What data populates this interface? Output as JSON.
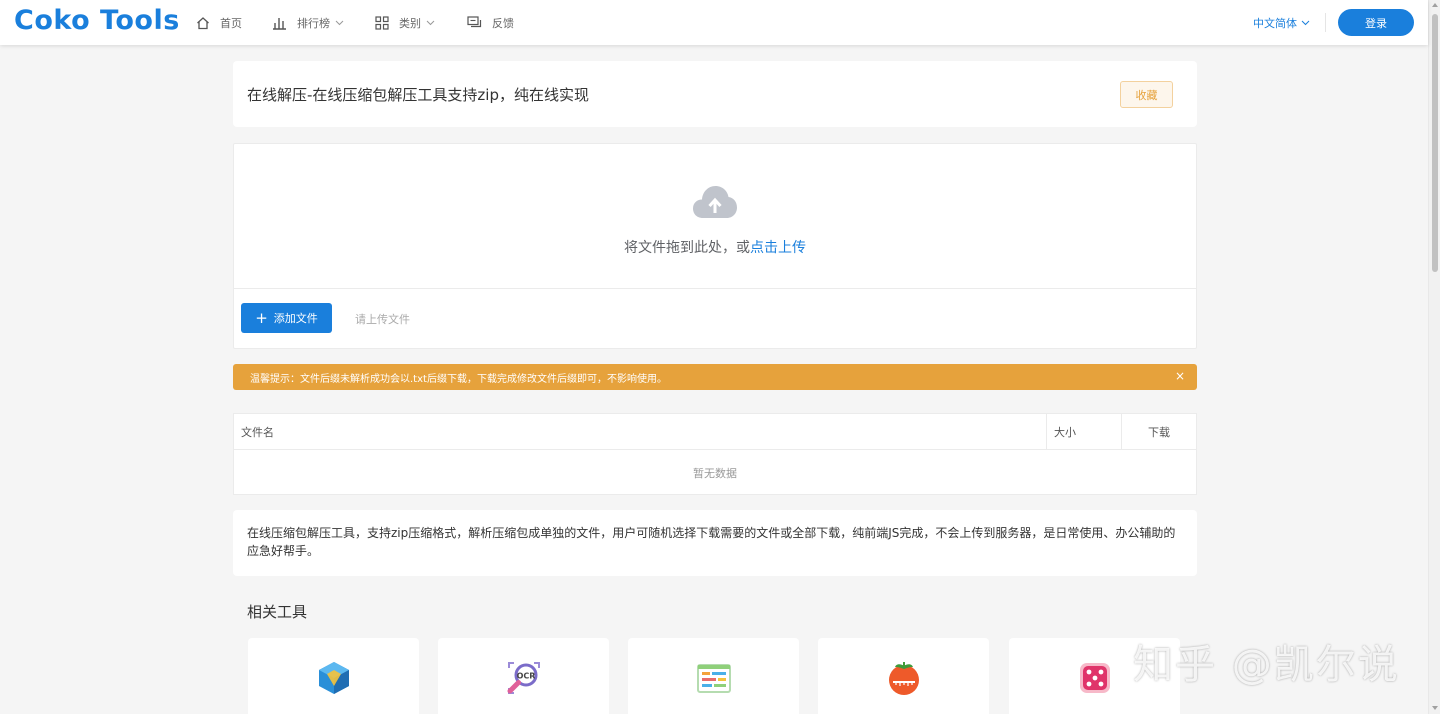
{
  "header": {
    "logo": "Coko Tools",
    "nav": [
      {
        "label": "首页",
        "icon": "home-icon"
      },
      {
        "label": "排行榜",
        "icon": "bar-chart-icon"
      },
      {
        "label": "类别",
        "icon": "grid-icon"
      },
      {
        "label": "反馈",
        "icon": "chat-icon"
      }
    ],
    "language": "中文简体",
    "login_label": "登录"
  },
  "page": {
    "title": "在线解压-在线压缩包解压工具支持zip，纯在线实现",
    "favorite_label": "收藏"
  },
  "upload": {
    "drop_text": "将文件拖到此处，或",
    "drop_link": "点击上传",
    "add_button": "添加文件",
    "hint": "请上传文件"
  },
  "alert": {
    "text": "温馨提示：文件后缀未解析成功会以.txt后缀下载，下载完成修改文件后缀即可，不影响使用。"
  },
  "table": {
    "columns": [
      "文件名",
      "大小",
      "下载"
    ],
    "empty_text": "暂无数据"
  },
  "description": "在线压缩包解压工具，支持zip压缩格式，解析压缩包成单独的文件，用户可随机选择下载需要的文件或全部下载，纯前端JS完成，不会上传到服务器，是日常使用、办公辅助的应急好帮手。",
  "related": {
    "title": "相关工具",
    "tools": [
      {
        "icon": "cube-icon"
      },
      {
        "icon": "ocr-magnifier-icon"
      },
      {
        "icon": "chart-board-icon"
      },
      {
        "icon": "tomato-timer-icon"
      },
      {
        "icon": "dice-icon"
      }
    ]
  },
  "watermark": "知乎 @凯尔说",
  "colors": {
    "primary": "#1a7fdc",
    "warning": "#e6a23c",
    "background": "#f5f5f5"
  }
}
